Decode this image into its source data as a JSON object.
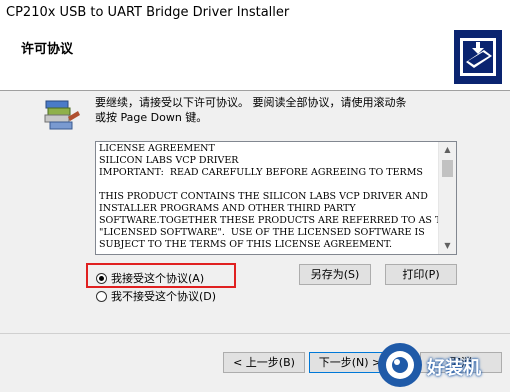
{
  "window": {
    "title": "CP210x USB to UART Bridge Driver Installer"
  },
  "header": {
    "title": "许可协议"
  },
  "instruction": {
    "line1": "要继续，请接受以下许可协议。 要阅读全部协议，请使用滚动条",
    "line2": "或按 Page Down 键。"
  },
  "license": {
    "lines": [
      "LICENSE AGREEMENT",
      "SILICON LABS VCP DRIVER",
      "IMPORTANT:  READ CAREFULLY BEFORE AGREEING TO TERMS",
      "",
      "THIS PRODUCT CONTAINS THE SILICON LABS VCP DRIVER AND",
      "INSTALLER PROGRAMS AND OTHER THIRD PARTY",
      "SOFTWARE.TOGETHER THESE PRODUCTS ARE REFERRED TO AS THE",
      "\"LICENSED SOFTWARE\".  USE OF THE LICENSED SOFTWARE IS",
      "SUBJECT TO THE TERMS OF THIS LICENSE AGREEMENT."
    ]
  },
  "options": {
    "accept": "我接受这个协议(A)",
    "decline": "我不接受这个协议(D)",
    "selected": "accept"
  },
  "buttons": {
    "save_as": "另存为(S)",
    "print": "打印(P)",
    "back": "< 上一步(B)",
    "next": "下一步(N) >",
    "cancel": "取消"
  },
  "watermark": {
    "text": "好装机"
  },
  "colors": {
    "highlight": "#e02020",
    "watermark": "#1f5aa8"
  }
}
